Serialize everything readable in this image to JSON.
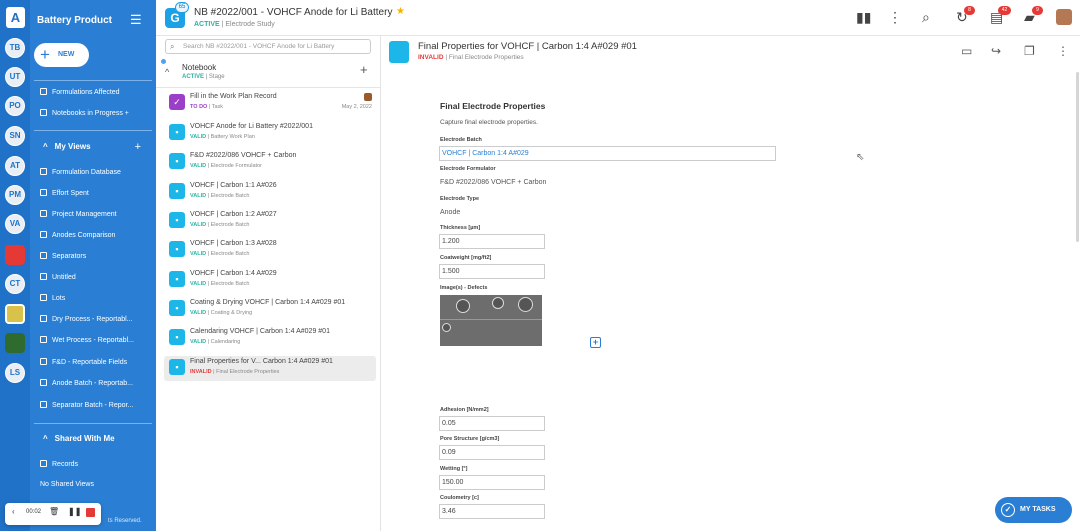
{
  "rail": {
    "logo": "A",
    "items": [
      "TB",
      "UT",
      "PO",
      "SN",
      "AT",
      "PM",
      "VA",
      "CT",
      "LS"
    ]
  },
  "sidebar": {
    "title": "Battery Product",
    "new_label": "NEW",
    "top_items": [
      "Formulations Affected",
      "Notebooks in Progress"
    ],
    "my_views_label": "My Views",
    "views": [
      "Formulation Database",
      "Effort Spent",
      "Project Management",
      "Anodes Comparison",
      "Separators",
      "Untitled",
      "Lots",
      "Dry Process - Reportabl...",
      "Wet Process - Reportabl...",
      "F&D - Reportable Fields",
      "Anode Batch - Reportab...",
      "Separator Batch - Repor..."
    ],
    "shared_label": "Shared With Me",
    "shared_items": [
      "Records"
    ],
    "no_shared": "No Shared Views",
    "footer": "ts Reserved."
  },
  "recorder": {
    "time": "00:02"
  },
  "topbar": {
    "badge": "65",
    "title": "NB #2022/001 - VOHCF Anode for Li Battery",
    "status": "ACTIVE",
    "subtitle": "Electrode Study",
    "notif_counts": [
      "8",
      "42",
      "9"
    ]
  },
  "notebook_panel": {
    "search_placeholder": "Search NB #2022/001 - VOHCF Anode for Li Battery",
    "head": "Notebook",
    "head_status": "ACTIVE",
    "head_sub": "Stage",
    "entries": [
      {
        "title": "Fill in the Work Plan Record",
        "status": "TO DO",
        "sub": "Task",
        "date": "May 2, 2022"
      },
      {
        "title": "VOHCF Anode for Li Battery #2022/001",
        "status": "VALID",
        "sub": "Battery Work Plan"
      },
      {
        "title": "F&D #2022/086 VOHCF + Carbon",
        "status": "VALID",
        "sub": "Electrode Formulator"
      },
      {
        "title": "VOHCF | Carbon 1:1 A#026",
        "status": "VALID",
        "sub": "Electrode Batch"
      },
      {
        "title": "VOHCF | Carbon 1:2 A#027",
        "status": "VALID",
        "sub": "Electrode Batch"
      },
      {
        "title": "VOHCF | Carbon 1:3 A#028",
        "status": "VALID",
        "sub": "Electrode Batch"
      },
      {
        "title": "VOHCF | Carbon 1:4 A#029",
        "status": "VALID",
        "sub": "Electrode Batch"
      },
      {
        "title": "Coating & Drying VOHCF | Carbon 1:4 A#029 #01",
        "status": "VALID",
        "sub": "Coating & Drying"
      },
      {
        "title": "Calendaring VOHCF | Carbon 1:4 A#029 #01",
        "status": "VALID",
        "sub": "Calendaring"
      },
      {
        "title": "Final Properties for V... Carbon 1:4 A#029 #01",
        "status": "INVALID",
        "sub": "Final Electrode Properties"
      }
    ]
  },
  "doc": {
    "title": "Final Properties for VOHCF | Carbon 1:4 A#029 #01",
    "status": "INVALID",
    "subtitle": "Final Electrode Properties",
    "form_title": "Final Electrode Properties",
    "form_desc": "Capture final electrode properties.",
    "electrode_batch_label": "Electrode Batch",
    "electrode_batch_value": "VOHCF | Carbon 1:4 A#029",
    "formulator_label": "Electrode Formulator",
    "formulator_value": "F&D #2022/086 VOHCF + Carbon",
    "type_label": "Electrode Type",
    "type_value": "Anode",
    "thickness_label": "Thickness [µm]",
    "thickness_value": "1.200",
    "coatweight_label": "Coatweight [mg/ft2]",
    "coatweight_value": "1.500",
    "images_label": "Image(s) - Defects",
    "adhesion_label": "Adhesion [N/mm2]",
    "adhesion_value": "0.05",
    "pore_label": "Pore Structure [g/cm3]",
    "pore_value": "0.09",
    "wetting_label": "Wetting [°]",
    "wetting_value": "150.00",
    "coulometry_label": "Coulometry [c]",
    "coulometry_value": "3.46"
  },
  "tasks_label": "MY TASKS"
}
